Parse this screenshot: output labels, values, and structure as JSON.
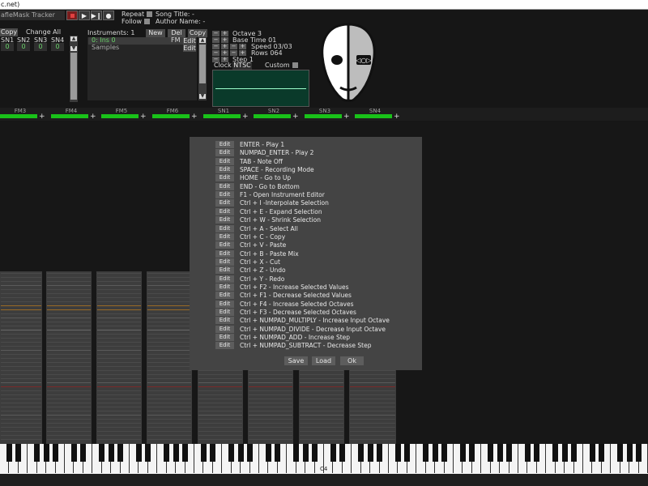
{
  "window": {
    "title_fragment": "c.net)"
  },
  "transport": {
    "app_label": "afleMask Tracker",
    "repeat_label": "Repeat",
    "follow_label": "Follow",
    "song_title_label": "Song Title: -",
    "author_label": "Author Name: -"
  },
  "channels": {
    "copy_label": "Copy",
    "change_all_label": "Change All",
    "names": [
      "SN1",
      "SN2",
      "SN3",
      "SN4"
    ],
    "values": [
      "0",
      "0",
      "0",
      "0"
    ]
  },
  "instruments": {
    "title": "Instruments: 1",
    "new_label": "New",
    "del_label": "Del",
    "copy_label": "Copy",
    "items": [
      {
        "name": "0: Ins 0",
        "type": "FM",
        "edit": "Edit"
      },
      {
        "name": "Samples",
        "type": "",
        "edit": "Edit"
      }
    ]
  },
  "song": {
    "octave": "Octave 3",
    "base_time": "Base Time 01",
    "speed": "Speed 03/03",
    "rows": "Rows 064",
    "step": "Step 1",
    "clock_label": "Clock",
    "clock_value": "NTSC",
    "custom_label": "Custom"
  },
  "tracks": {
    "labels": [
      "FM3",
      "FM4",
      "FM5",
      "FM6",
      "SN1",
      "SN2",
      "SN3",
      "SN4"
    ],
    "plus": "+"
  },
  "keybind_dialog": {
    "edit_label": "Edit",
    "bindings": [
      "ENTER - Play 1",
      "NUMPAD_ENTER - Play 2",
      "TAB - Note Off",
      "SPACE - Recording Mode",
      "HOME - Go to Up",
      "END - Go to Bottom",
      "F1 - Open Instrument Editor",
      "Ctrl + I -Interpolate Selection",
      "Ctrl + E - Expand Selection",
      "Ctrl + W - Shrink Selection",
      "Ctrl + A - Select All",
      "Ctrl + C - Copy",
      "Ctrl + V - Paste",
      "Ctrl + B - Paste Mix",
      "Ctrl + X - Cut",
      "Ctrl + Z - Undo",
      "Ctrl + Y - Redo",
      "Ctrl + F2 - Increase Selected Values",
      "Ctrl + F1 - Decrease Selected Values",
      "Ctrl + F4 - Increase Selected Octaves",
      "Ctrl + F3 - Decrease Selected Octaves",
      "Ctrl + NUMPAD_MULTIPLY - Increase Input Octave",
      "Ctrl + NUMPAD_DIVIDE - Decrease Input Octave",
      "Ctrl + NUMPAD_ADD - Increase Step",
      "Ctrl + NUMPAD_SUBTRACT - Decrease Step"
    ],
    "save_label": "Save",
    "load_label": "Load",
    "ok_label": "Ok"
  },
  "piano": {
    "c4_label": "C4"
  },
  "colors": {
    "accent_green": "#19c219",
    "stop_red": "#c0392b",
    "dialog_bg": "#444444"
  }
}
